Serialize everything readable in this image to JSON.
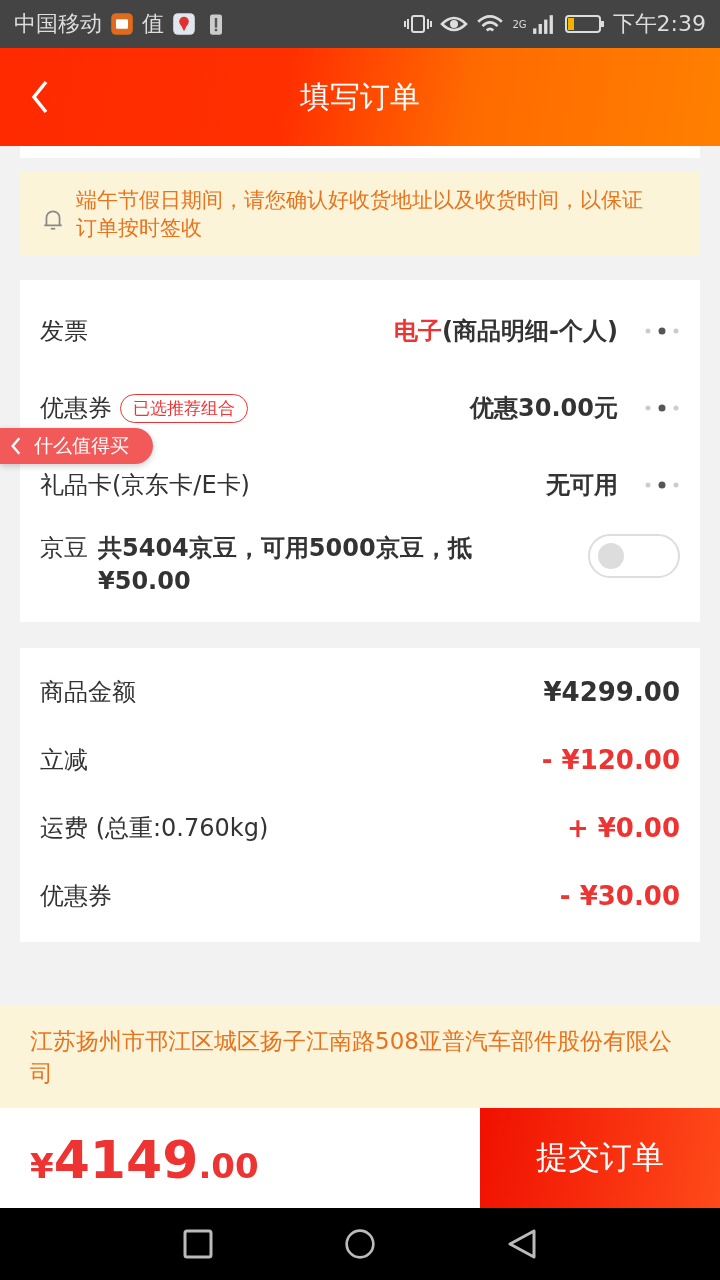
{
  "status_bar": {
    "carrier": "中国移动",
    "notif_char": "值",
    "network": "2G",
    "time": "下午2:39"
  },
  "header": {
    "title": "填写订单"
  },
  "notice": {
    "text": "端午节假日期间，请您确认好收货地址以及收货时间，以保证订单按时签收"
  },
  "options": [
    {
      "kind": "link",
      "label": "发票",
      "value_highlight": "电子",
      "value": "(商品明细-个人)"
    },
    {
      "kind": "link",
      "label": "优惠券",
      "tag": "已选推荐组合",
      "value": "优惠30.00元"
    },
    {
      "kind": "link",
      "label": "礼品卡(京东卡/E卡)",
      "value": "无可用"
    },
    {
      "kind": "toggle",
      "label": "京豆",
      "value": "共5404京豆，可用5000京豆，抵¥50.00",
      "on": false
    }
  ],
  "floating_tab": {
    "label": "什么值得买"
  },
  "summary": [
    {
      "label": "商品金额",
      "value": "¥4299.00",
      "highlight": false
    },
    {
      "label": "立减",
      "value": "- ¥120.00",
      "highlight": true
    },
    {
      "label": "运费 (总重:0.760kg)",
      "value": "+ ¥0.00",
      "highlight": true
    },
    {
      "label": "优惠券",
      "value": "- ¥30.00",
      "highlight": true
    }
  ],
  "address": {
    "text": "江苏扬州市邗江区城区扬子江南路508亚普汽车部件股份有限公司"
  },
  "footer": {
    "currency": "¥",
    "integer": "4149",
    "decimal": ".00",
    "submit": "提交订单"
  }
}
